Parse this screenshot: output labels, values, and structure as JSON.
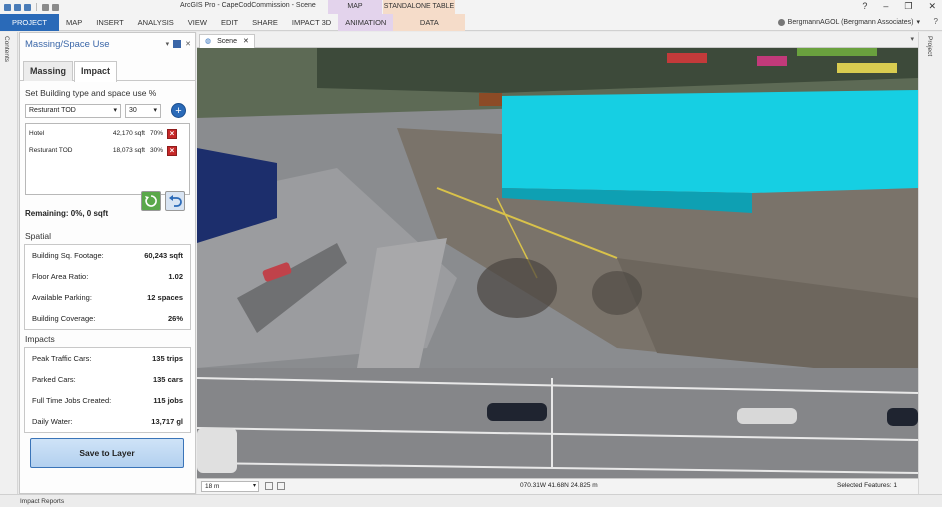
{
  "app": {
    "title": "ArcGIS Pro - CapeCodCommission - Scene",
    "window_controls": [
      "?",
      "–",
      "❐",
      "✕"
    ]
  },
  "contextual_headers": {
    "map": "MAP",
    "standalone_table": "STANDALONE TABLE"
  },
  "ribbon": {
    "tabs": [
      "PROJECT",
      "MAP",
      "INSERT",
      "ANALYSIS",
      "VIEW",
      "EDIT",
      "SHARE",
      "IMPACT 3D",
      "ANIMATION",
      "DATA"
    ],
    "user": "BergmannAGOL (Bergmann Associates)",
    "help": "?"
  },
  "side_strips": {
    "left": "Contents",
    "right": "Project"
  },
  "pane": {
    "title": "Massing/Space Use",
    "tabs": [
      "Massing",
      "Impact"
    ],
    "active_tab": "Impact",
    "set_label": "Set Building type and space use %",
    "type_select": "Resturant TOD",
    "pct_select": "30",
    "uses": [
      {
        "name": "Hotel",
        "sqft": "42,170 sqft",
        "pct": "70%"
      },
      {
        "name": "Resturant TOD",
        "sqft": "18,073 sqft",
        "pct": "30%"
      }
    ],
    "remaining": "Remaining: 0%, 0 sqft",
    "spatial_heading": "Spatial",
    "spatial": [
      {
        "label": "Building Sq. Footage:",
        "value": "60,243 sqft"
      },
      {
        "label": "Floor Area Ratio:",
        "value": "1.02"
      },
      {
        "label": "Available Parking:",
        "value": "12 spaces"
      },
      {
        "label": "Building Coverage:",
        "value": "26%"
      }
    ],
    "impacts_heading": "Impacts",
    "impacts": [
      {
        "label": "Peak Traffic Cars:",
        "value": "135 trips"
      },
      {
        "label": "Parked Cars:",
        "value": "135 cars"
      },
      {
        "label": "Full Time Jobs Created:",
        "value": "115 jobs"
      },
      {
        "label": "Daily Water:",
        "value": "13,717 gl"
      }
    ],
    "save_button": "Save to Layer"
  },
  "scene": {
    "tab_label": "Scene",
    "scale": "18 m",
    "coordinates": "070.31W 41.68N   24.825 m",
    "selected_features": "Selected Features: 1",
    "building_color": "#16cfe3"
  },
  "bottom_bar": {
    "label": "Impact Reports"
  }
}
